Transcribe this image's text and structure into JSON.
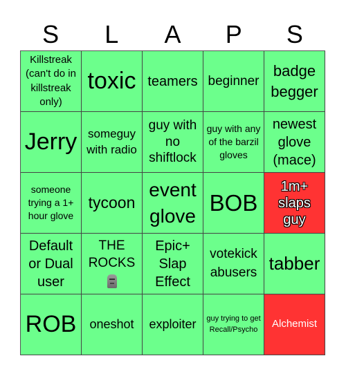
{
  "title_letters": [
    "S",
    "L",
    "A",
    "P",
    "S"
  ],
  "colors": {
    "marked": "#6cff8c",
    "special": "#ff3333"
  },
  "rows": [
    [
      {
        "text": "Killstreak (can't do in killstreak only)",
        "state": "green"
      },
      {
        "text": "toxic",
        "state": "green"
      },
      {
        "text": "teamers",
        "state": "green"
      },
      {
        "text": "beginner",
        "state": "green"
      },
      {
        "text": "badge begger",
        "state": "green"
      }
    ],
    [
      {
        "text": "Jerry",
        "state": "green"
      },
      {
        "text": "someguy with radio",
        "state": "green"
      },
      {
        "text": "guy with no shiftlock",
        "state": "green"
      },
      {
        "text": "guy with any of the barzil gloves",
        "state": "green"
      },
      {
        "text": "newest glove (mace)",
        "state": "green"
      }
    ],
    [
      {
        "text": "someone trying a 1+ hour glove",
        "state": "green"
      },
      {
        "text": "tycoon",
        "state": "green"
      },
      {
        "text": "event glove",
        "state": "green"
      },
      {
        "text": "BOB",
        "state": "green"
      },
      {
        "text": "1m+ slaps guy",
        "state": "red"
      }
    ],
    [
      {
        "text": "Default or Dual user",
        "state": "green"
      },
      {
        "text": "THE ROCKS",
        "icon": "moai-icon",
        "state": "green"
      },
      {
        "text": "Epic+ Slap Effect",
        "state": "green"
      },
      {
        "text": "votekick abusers",
        "state": "green"
      },
      {
        "text": "tabber",
        "state": "green"
      }
    ],
    [
      {
        "text": "ROB",
        "state": "green"
      },
      {
        "text": "oneshot",
        "state": "green"
      },
      {
        "text": "exploiter",
        "state": "green"
      },
      {
        "text": "guy trying to get Recall/Psycho",
        "state": "green"
      },
      {
        "text": "Alchemist",
        "state": "red"
      }
    ]
  ]
}
